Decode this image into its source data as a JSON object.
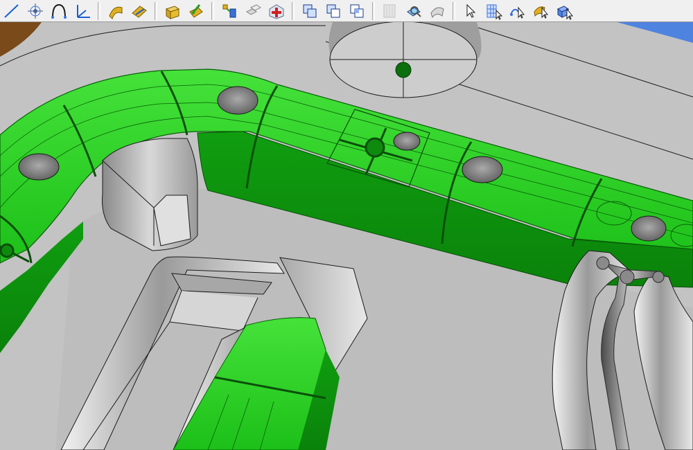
{
  "toolbar": {
    "groups": [
      [
        {
          "icon": "line-icon",
          "enabled": true
        },
        {
          "icon": "point-icon",
          "enabled": true
        },
        {
          "icon": "arc-icon",
          "enabled": true
        },
        {
          "icon": "coordinate-system-icon",
          "enabled": true
        }
      ],
      [
        {
          "icon": "sweep-surface-icon",
          "enabled": true
        },
        {
          "icon": "trim-surface-icon",
          "enabled": true
        }
      ],
      [
        {
          "icon": "extrude-solid-icon",
          "enabled": true
        },
        {
          "icon": "pull-face-icon",
          "enabled": true
        }
      ],
      [
        {
          "icon": "assembly-icon",
          "enabled": true
        },
        {
          "icon": "copy-bodies-icon",
          "enabled": true
        },
        {
          "icon": "heal-geometry-icon",
          "enabled": true
        }
      ],
      [
        {
          "icon": "boolean-union-icon",
          "enabled": true
        },
        {
          "icon": "boolean-subtract-icon",
          "enabled": true
        },
        {
          "icon": "boolean-intersect-icon",
          "enabled": true
        }
      ],
      [
        {
          "icon": "section-view-icon",
          "enabled": false
        },
        {
          "icon": "analyze-geometry-icon",
          "enabled": true
        },
        {
          "icon": "surface-check-icon",
          "enabled": true
        }
      ],
      [
        {
          "icon": "select-arrow-icon",
          "enabled": true
        },
        {
          "icon": "select-mesh-icon",
          "enabled": true
        },
        {
          "icon": "select-curve-icon",
          "enabled": true
        },
        {
          "icon": "select-surface-icon",
          "enabled": true
        },
        {
          "icon": "select-solid-icon",
          "enabled": true
        }
      ]
    ]
  },
  "viewport": {
    "model": "cad-mold-core-with-green-cooling-channel",
    "colors": {
      "background": "#c3c3c3",
      "channel_green": "#22c91e",
      "channel_dark": "#0e9a0e",
      "steel_light": "#e4e4e4",
      "steel_dark": "#7c7c7c",
      "edge": "#1a1a1a",
      "accent_blue": "#4f83e0",
      "accent_brown": "#7a4a1a"
    }
  }
}
